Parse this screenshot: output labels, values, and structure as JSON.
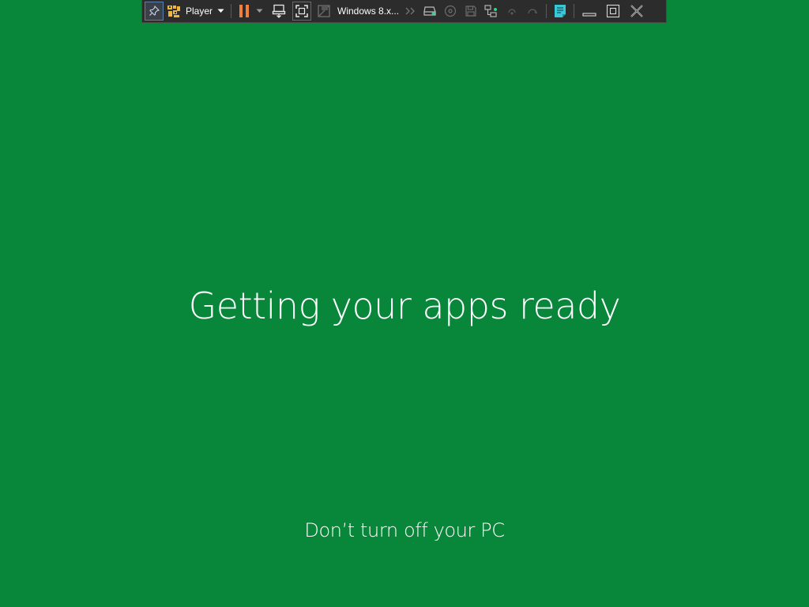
{
  "screen": {
    "background_color": "#08873a",
    "heading": "Getting your apps ready",
    "subheading": "Don’t turn off your PC"
  },
  "toolbar": {
    "app_label": "Player",
    "vm_name": "Windows 8.x...",
    "accent_pause": "#f0803c",
    "accent_notes": "#38c7d6",
    "icons": [
      "pin-icon",
      "player-logo-icon",
      "chevron-down-icon",
      "pause-icon",
      "send-ctrl-alt-del-icon",
      "fullscreen-icon",
      "unity-icon",
      "more-icon",
      "hard-disk-icon",
      "cd-icon",
      "floppy-icon",
      "network-icon",
      "usb-icon",
      "sound-icon",
      "notes-icon",
      "minimize-icon",
      "restore-icon",
      "close-icon"
    ]
  }
}
